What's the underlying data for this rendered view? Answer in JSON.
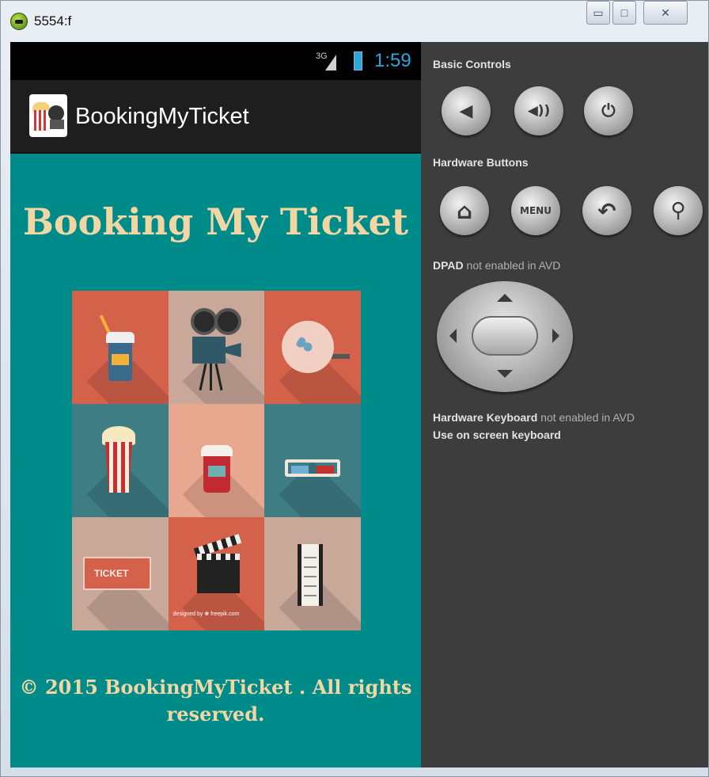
{
  "window": {
    "title": "5554:f",
    "minimize_glyph": "▭",
    "maximize_glyph": "□",
    "close_glyph": "✕"
  },
  "status_bar": {
    "network": "3G",
    "time": "1:59"
  },
  "action_bar": {
    "title": "BookingMyTicket"
  },
  "app": {
    "heading": "Booking My Ticket",
    "grid_icons": [
      "drink-cup-icon",
      "film-projector-icon",
      "film-reel-icon",
      "popcorn-icon",
      "coffee-cup-icon",
      "3d-glasses-icon",
      "ticket-icon",
      "clapperboard-icon",
      "film-strip-icon"
    ],
    "ticket_text": "TICKET",
    "credit": "designed by ❀ freepik.com",
    "footer_line1": "© 2015 BookingMyTicket . All rights",
    "footer_line2": "reserved."
  },
  "controls": {
    "basic_label": "Basic Controls",
    "basic_buttons": [
      {
        "name": "volume-down",
        "glyph": "◀"
      },
      {
        "name": "volume-up",
        "glyph": "◀))"
      },
      {
        "name": "power",
        "glyph": "⏻"
      }
    ],
    "hardware_label": "Hardware Buttons",
    "hardware_buttons": [
      {
        "name": "home",
        "glyph": "⌂"
      },
      {
        "name": "menu",
        "glyph": "MENU"
      },
      {
        "name": "back",
        "glyph": "↶"
      },
      {
        "name": "search",
        "glyph": "⚲"
      }
    ],
    "dpad_label_strong": "DPAD",
    "dpad_label_rest": " not enabled in AVD",
    "keyboard_label_strong": "Hardware Keyboard",
    "keyboard_label_rest": " not enabled in AVD",
    "keyboard_hint": "Use on screen keyboard"
  },
  "colors": {
    "app_background": "#008b8b",
    "heading_color": "#f2d7a4",
    "panel_background": "#3d3d3d",
    "clock_color": "#2aa7d9"
  }
}
